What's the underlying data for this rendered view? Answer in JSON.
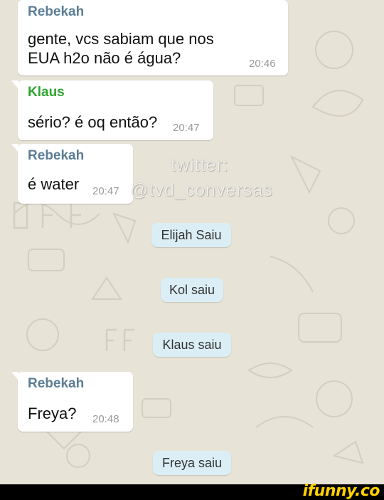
{
  "messages": [
    {
      "sender": "Rebekah",
      "text": "gente, vcs sabiam que nos\nEUA h2o não é água?",
      "time": "20:46"
    },
    {
      "sender": "Klaus",
      "text": "sério? é oq então?",
      "time": "20:47"
    },
    {
      "sender": "Rebekah",
      "text": "é water",
      "time": "20:47"
    },
    {
      "sender": "Rebekah",
      "text": "Freya?",
      "time": "20:48"
    }
  ],
  "system_messages": [
    "Elijah Saiu",
    "Kol saiu",
    "Klaus saiu",
    "Freya saiu"
  ],
  "watermark": {
    "line1": "twitter:",
    "line2": "@tvd_conversas"
  },
  "footer": {
    "logo": "ifunny.co"
  },
  "colors": {
    "rebekah": "#5b7d94",
    "klaus": "#2fa52f",
    "system_bubble": "#dbeef6",
    "wallpaper": "#e7e3d6",
    "logo": "#ffd200"
  }
}
